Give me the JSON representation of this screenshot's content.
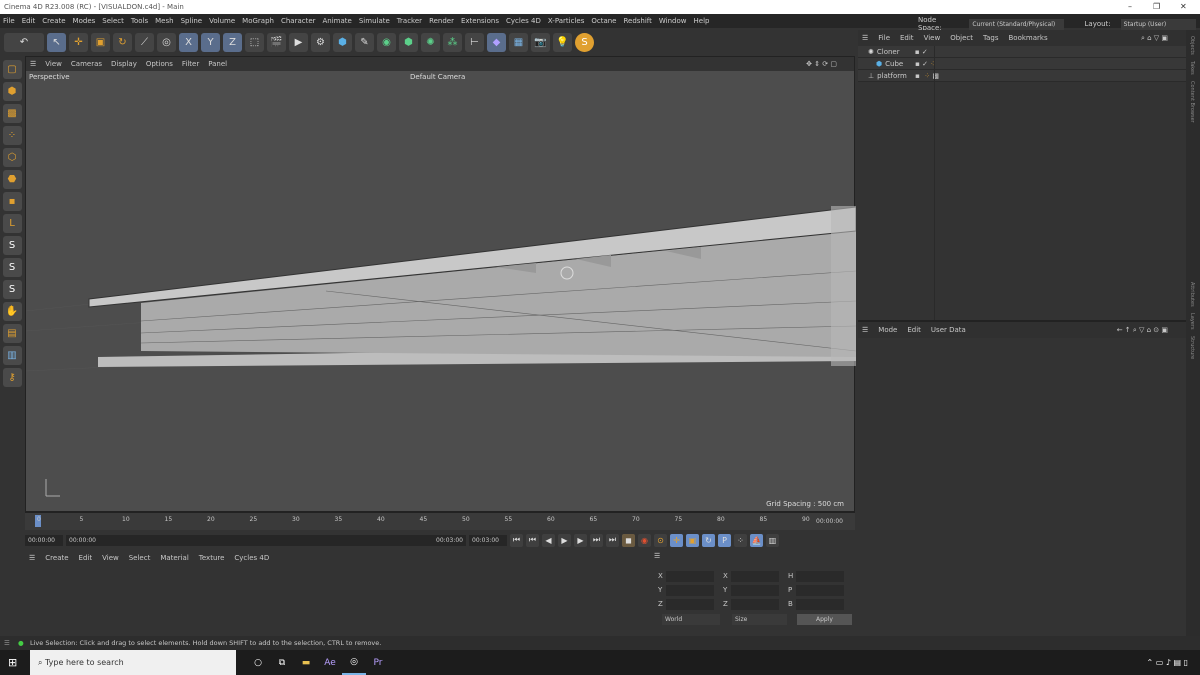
{
  "window": {
    "title": "Cinema 4D R23.008 (RC) - [VISUALDON.c4d] - Main"
  },
  "menu": [
    "File",
    "Edit",
    "Create",
    "Modes",
    "Select",
    "Tools",
    "Mesh",
    "Spline",
    "Volume",
    "MoGraph",
    "Character",
    "Animate",
    "Simulate",
    "Tracker",
    "Render",
    "Extensions",
    "Cycles 4D",
    "X-Particles",
    "Octane",
    "Redshift",
    "Window",
    "Help"
  ],
  "node_space": {
    "label": "Node Space:",
    "value": "Current (Standard/Physical)"
  },
  "layout": {
    "label": "Layout:",
    "value": "Startup (User)"
  },
  "viewport": {
    "menu": [
      "View",
      "Cameras",
      "Display",
      "Options",
      "Filter",
      "Panel"
    ],
    "view_name": "Perspective",
    "camera": "Default Camera",
    "grid_spacing": "Grid Spacing : 500 cm"
  },
  "object_manager": {
    "menu": [
      "File",
      "Edit",
      "View",
      "Object",
      "Tags",
      "Bookmarks"
    ],
    "objects": [
      {
        "name": "Cloner"
      },
      {
        "name": "Cube"
      },
      {
        "name": "platform"
      }
    ]
  },
  "attributes": {
    "menu": [
      "Mode",
      "Edit",
      "User Data"
    ]
  },
  "side_tabs": [
    "Objects",
    "Takes",
    "Content Browser",
    "Attributes",
    "Layers",
    "Structure"
  ],
  "timeline": {
    "ticks": [
      "0",
      "5",
      "10",
      "15",
      "20",
      "25",
      "30",
      "35",
      "40",
      "45",
      "50",
      "55",
      "60",
      "65",
      "70",
      "75",
      "80",
      "85",
      "90"
    ],
    "end_frame": "00:00:00"
  },
  "controls": {
    "current": "00:00:00",
    "start": "00:00:00",
    "end": "00:03:00",
    "max": "00:03:00"
  },
  "material_manager": {
    "menu": [
      "Create",
      "Edit",
      "View",
      "Select",
      "Material",
      "Texture",
      "Cycles 4D"
    ]
  },
  "coordinates": {
    "col1": [
      "X",
      "Y",
      "Z"
    ],
    "col2": [
      "X",
      "Y",
      "Z"
    ],
    "col3": [
      "H",
      "P",
      "B"
    ],
    "mode": "World",
    "size": "Size",
    "apply": "Apply"
  },
  "status": "Live Selection: Click and drag to select elements. Hold down SHIFT to add to the selection, CTRL to remove.",
  "taskbar": {
    "search_placeholder": "Type here to search"
  }
}
